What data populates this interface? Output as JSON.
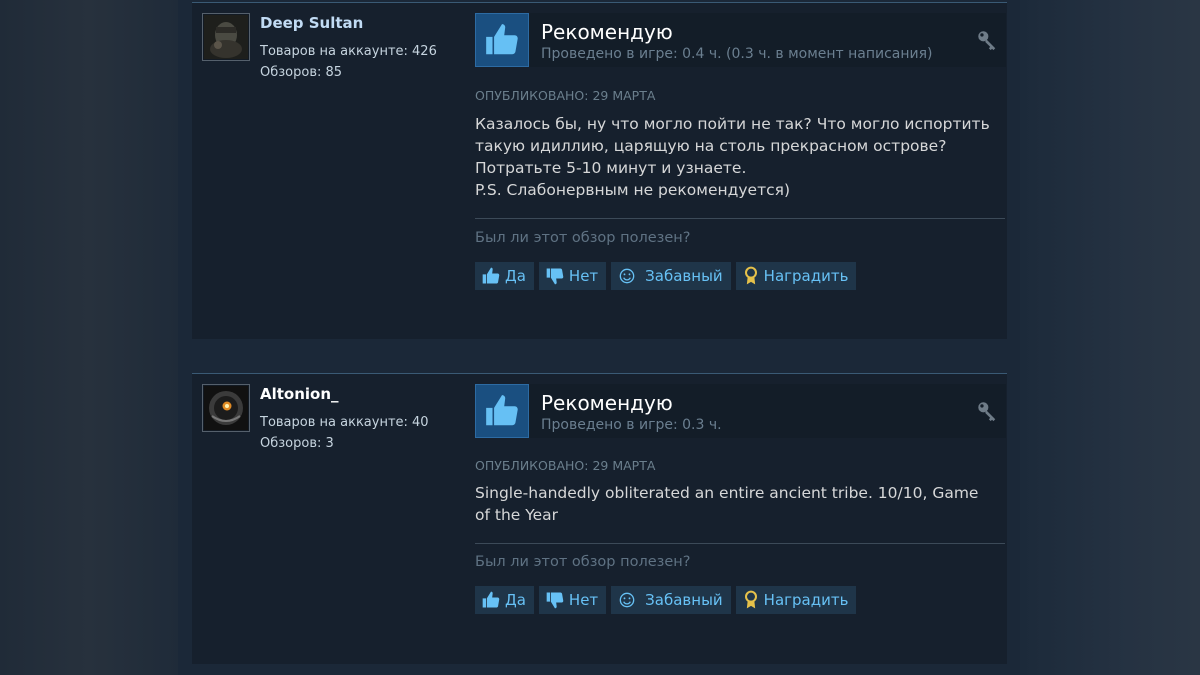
{
  "reviews": [
    {
      "author": "Deep Sultan",
      "products": "Товаров на аккаунте: 426",
      "reviews_count": "Обзоров: 85",
      "vote": "Рекомендую",
      "hours": "Проведено в игре: 0.4 ч. (0.3 ч. в момент написания)",
      "posted": "ОПУБЛИКОВАНО: 29 МАРТА",
      "text": "Казалось бы, ну что могло пойти не так? Что могло испортить\nтакую идиллию, царящую на столь прекрасном острове?\nПотратьте 5-10 минут и узнаете.\nP.S. Слабонервным не рекомендуется)",
      "helpful_question": "Был ли этот обзор полезен?",
      "buttons": {
        "yes": "Да",
        "no": "Нет",
        "funny": "Забавный",
        "award": "Наградить"
      }
    },
    {
      "author": "Altonion_",
      "products": "Товаров на аккаунте: 40",
      "reviews_count": "Обзоров: 3",
      "vote": "Рекомендую",
      "hours": "Проведено в игре: 0.3 ч.",
      "posted": "ОПУБЛИКОВАНО: 29 МАРТА",
      "text": "Single-handedly obliterated an entire ancient tribe. 10/10, Game\nof the Year",
      "helpful_question": "Был ли этот обзор полезен?",
      "buttons": {
        "yes": "Да",
        "no": "Нет",
        "funny": "Забавный",
        "award": "Наградить"
      }
    }
  ],
  "icons": {
    "recommend": "thumbs-up-icon",
    "key": "key-icon",
    "yes": "thumbs-up-icon",
    "no": "thumbs-down-icon",
    "funny": "smiley-icon",
    "award": "award-ribbon-icon"
  },
  "colors": {
    "page_bg": "#1b2838",
    "card_bg": "#16202d",
    "link_blue": "#67c1f5",
    "thumb_bg": "#1a4f80",
    "button_bg": "#1f3549",
    "award_gold": "#e5c14a"
  }
}
